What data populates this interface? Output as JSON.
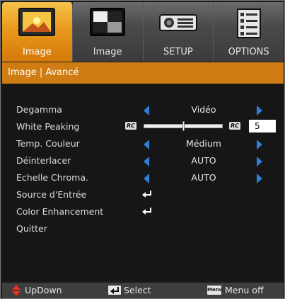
{
  "tabs": [
    {
      "label": "Image",
      "icon": "image-landscape-icon",
      "active": true
    },
    {
      "label": "Image",
      "icon": "image-contrast-icon",
      "active": false
    },
    {
      "label": "SETUP",
      "icon": "projector-icon",
      "active": false
    },
    {
      "label": "OPTIONS",
      "icon": "options-list-icon",
      "active": false
    }
  ],
  "header": {
    "title": "Image | Avancé"
  },
  "rows": [
    {
      "label": "Degamma",
      "value": "Vidéo"
    },
    {
      "label": "White Peaking",
      "value": "5",
      "slider_fraction": 0.5
    },
    {
      "label": "Temp. Couleur",
      "value": "Médium"
    },
    {
      "label": "Déinterlacer",
      "value": "AUTO"
    },
    {
      "label": "Echelle Chroma.",
      "value": "AUTO"
    },
    {
      "label": "Source d'Entrée"
    },
    {
      "label": "Color Enhancement"
    },
    {
      "label": "Quitter"
    }
  ],
  "slider": {
    "rc_label": "RC"
  },
  "footer": {
    "updown": "UpDown",
    "select": "Select",
    "menu_icon": "Menu",
    "menu_off": "Menu off"
  },
  "colors": {
    "accent": "#d4790a",
    "arrow": "#2f7fd6",
    "panel": "#161616"
  }
}
